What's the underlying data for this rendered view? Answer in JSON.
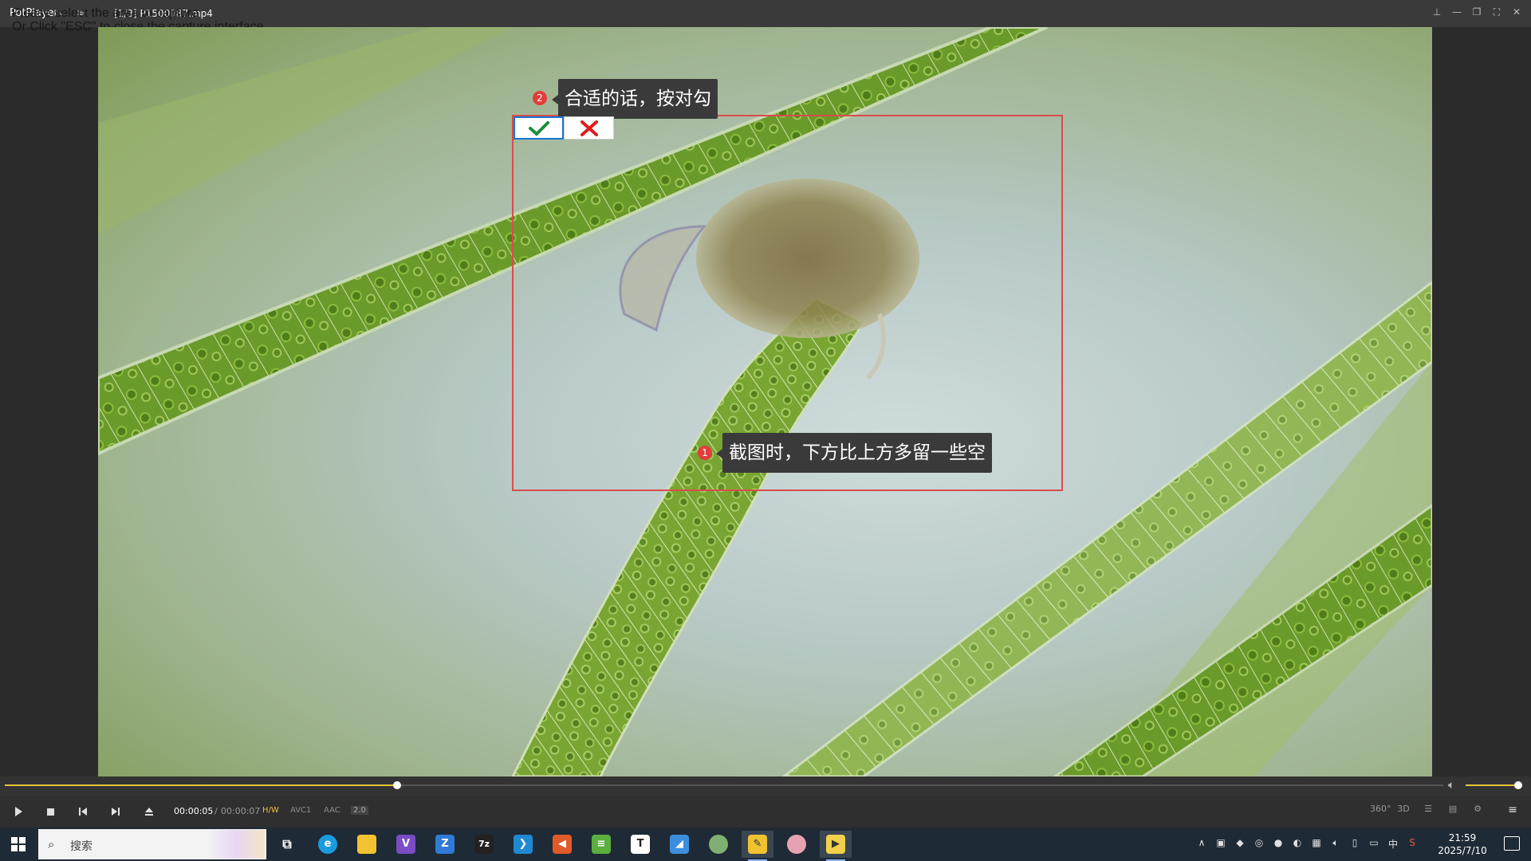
{
  "window": {
    "brand": "PotPlayer",
    "file_title": "[1/3] P1500087.mp4",
    "controls": [
      "pin-icon",
      "minimize-icon",
      "restore-icon",
      "fullscreen-icon",
      "close-icon"
    ]
  },
  "capture": {
    "hint_line1": "Please select the area to capture",
    "hint_line2": "Or Click \"ESC\" to close the capture interface",
    "tip_confirm": "合适的话，按对勾",
    "tip_margin": "截图时，下方比上方多留一些空",
    "badge_1": "1",
    "badge_2": "2",
    "confirm_icon": "check-icon",
    "cancel_icon": "x-icon",
    "colors": {
      "border": "#d94c4c",
      "badge": "#e43c3c",
      "check": "#1a8f3c",
      "cross": "#e21b1b"
    }
  },
  "playback": {
    "current": "00:00:05",
    "separator": "/",
    "duration": "00:00:07",
    "progress": 0.273,
    "volume": 1.0,
    "hw": "H/W",
    "video_codec": "AVC1",
    "audio_codec": "AAC",
    "channels": "2.0",
    "right_buttons": [
      "360°",
      "3D"
    ]
  },
  "taskbar": {
    "search_placeholder": "搜索",
    "time": "21:59",
    "date": "2025/7/10",
    "ime": "中"
  },
  "theme": {
    "accent": "#e8c23a",
    "titlebar": "#3a3a3a",
    "controlbar": "#2f2f2f",
    "taskbar": "#1e2a35"
  }
}
